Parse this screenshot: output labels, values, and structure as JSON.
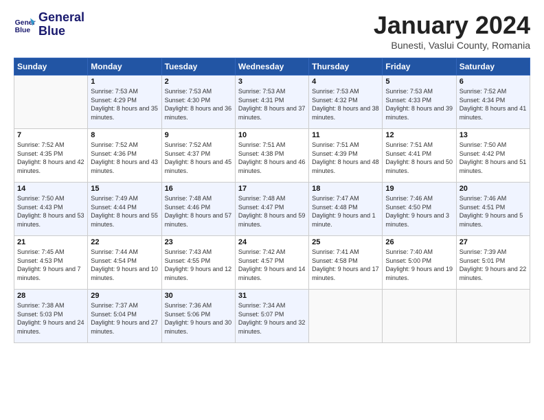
{
  "header": {
    "logo_line1": "General",
    "logo_line2": "Blue",
    "title": "January 2024",
    "subtitle": "Bunesti, Vaslui County, Romania"
  },
  "weekdays": [
    "Sunday",
    "Monday",
    "Tuesday",
    "Wednesday",
    "Thursday",
    "Friday",
    "Saturday"
  ],
  "weeks": [
    [
      {
        "day": "",
        "sunrise": "",
        "sunset": "",
        "daylight": ""
      },
      {
        "day": "1",
        "sunrise": "Sunrise: 7:53 AM",
        "sunset": "Sunset: 4:29 PM",
        "daylight": "Daylight: 8 hours and 35 minutes."
      },
      {
        "day": "2",
        "sunrise": "Sunrise: 7:53 AM",
        "sunset": "Sunset: 4:30 PM",
        "daylight": "Daylight: 8 hours and 36 minutes."
      },
      {
        "day": "3",
        "sunrise": "Sunrise: 7:53 AM",
        "sunset": "Sunset: 4:31 PM",
        "daylight": "Daylight: 8 hours and 37 minutes."
      },
      {
        "day": "4",
        "sunrise": "Sunrise: 7:53 AM",
        "sunset": "Sunset: 4:32 PM",
        "daylight": "Daylight: 8 hours and 38 minutes."
      },
      {
        "day": "5",
        "sunrise": "Sunrise: 7:53 AM",
        "sunset": "Sunset: 4:33 PM",
        "daylight": "Daylight: 8 hours and 39 minutes."
      },
      {
        "day": "6",
        "sunrise": "Sunrise: 7:52 AM",
        "sunset": "Sunset: 4:34 PM",
        "daylight": "Daylight: 8 hours and 41 minutes."
      }
    ],
    [
      {
        "day": "7",
        "sunrise": "Sunrise: 7:52 AM",
        "sunset": "Sunset: 4:35 PM",
        "daylight": "Daylight: 8 hours and 42 minutes."
      },
      {
        "day": "8",
        "sunrise": "Sunrise: 7:52 AM",
        "sunset": "Sunset: 4:36 PM",
        "daylight": "Daylight: 8 hours and 43 minutes."
      },
      {
        "day": "9",
        "sunrise": "Sunrise: 7:52 AM",
        "sunset": "Sunset: 4:37 PM",
        "daylight": "Daylight: 8 hours and 45 minutes."
      },
      {
        "day": "10",
        "sunrise": "Sunrise: 7:51 AM",
        "sunset": "Sunset: 4:38 PM",
        "daylight": "Daylight: 8 hours and 46 minutes."
      },
      {
        "day": "11",
        "sunrise": "Sunrise: 7:51 AM",
        "sunset": "Sunset: 4:39 PM",
        "daylight": "Daylight: 8 hours and 48 minutes."
      },
      {
        "day": "12",
        "sunrise": "Sunrise: 7:51 AM",
        "sunset": "Sunset: 4:41 PM",
        "daylight": "Daylight: 8 hours and 50 minutes."
      },
      {
        "day": "13",
        "sunrise": "Sunrise: 7:50 AM",
        "sunset": "Sunset: 4:42 PM",
        "daylight": "Daylight: 8 hours and 51 minutes."
      }
    ],
    [
      {
        "day": "14",
        "sunrise": "Sunrise: 7:50 AM",
        "sunset": "Sunset: 4:43 PM",
        "daylight": "Daylight: 8 hours and 53 minutes."
      },
      {
        "day": "15",
        "sunrise": "Sunrise: 7:49 AM",
        "sunset": "Sunset: 4:44 PM",
        "daylight": "Daylight: 8 hours and 55 minutes."
      },
      {
        "day": "16",
        "sunrise": "Sunrise: 7:48 AM",
        "sunset": "Sunset: 4:46 PM",
        "daylight": "Daylight: 8 hours and 57 minutes."
      },
      {
        "day": "17",
        "sunrise": "Sunrise: 7:48 AM",
        "sunset": "Sunset: 4:47 PM",
        "daylight": "Daylight: 8 hours and 59 minutes."
      },
      {
        "day": "18",
        "sunrise": "Sunrise: 7:47 AM",
        "sunset": "Sunset: 4:48 PM",
        "daylight": "Daylight: 9 hours and 1 minute."
      },
      {
        "day": "19",
        "sunrise": "Sunrise: 7:46 AM",
        "sunset": "Sunset: 4:50 PM",
        "daylight": "Daylight: 9 hours and 3 minutes."
      },
      {
        "day": "20",
        "sunrise": "Sunrise: 7:46 AM",
        "sunset": "Sunset: 4:51 PM",
        "daylight": "Daylight: 9 hours and 5 minutes."
      }
    ],
    [
      {
        "day": "21",
        "sunrise": "Sunrise: 7:45 AM",
        "sunset": "Sunset: 4:53 PM",
        "daylight": "Daylight: 9 hours and 7 minutes."
      },
      {
        "day": "22",
        "sunrise": "Sunrise: 7:44 AM",
        "sunset": "Sunset: 4:54 PM",
        "daylight": "Daylight: 9 hours and 10 minutes."
      },
      {
        "day": "23",
        "sunrise": "Sunrise: 7:43 AM",
        "sunset": "Sunset: 4:55 PM",
        "daylight": "Daylight: 9 hours and 12 minutes."
      },
      {
        "day": "24",
        "sunrise": "Sunrise: 7:42 AM",
        "sunset": "Sunset: 4:57 PM",
        "daylight": "Daylight: 9 hours and 14 minutes."
      },
      {
        "day": "25",
        "sunrise": "Sunrise: 7:41 AM",
        "sunset": "Sunset: 4:58 PM",
        "daylight": "Daylight: 9 hours and 17 minutes."
      },
      {
        "day": "26",
        "sunrise": "Sunrise: 7:40 AM",
        "sunset": "Sunset: 5:00 PM",
        "daylight": "Daylight: 9 hours and 19 minutes."
      },
      {
        "day": "27",
        "sunrise": "Sunrise: 7:39 AM",
        "sunset": "Sunset: 5:01 PM",
        "daylight": "Daylight: 9 hours and 22 minutes."
      }
    ],
    [
      {
        "day": "28",
        "sunrise": "Sunrise: 7:38 AM",
        "sunset": "Sunset: 5:03 PM",
        "daylight": "Daylight: 9 hours and 24 minutes."
      },
      {
        "day": "29",
        "sunrise": "Sunrise: 7:37 AM",
        "sunset": "Sunset: 5:04 PM",
        "daylight": "Daylight: 9 hours and 27 minutes."
      },
      {
        "day": "30",
        "sunrise": "Sunrise: 7:36 AM",
        "sunset": "Sunset: 5:06 PM",
        "daylight": "Daylight: 9 hours and 30 minutes."
      },
      {
        "day": "31",
        "sunrise": "Sunrise: 7:34 AM",
        "sunset": "Sunset: 5:07 PM",
        "daylight": "Daylight: 9 hours and 32 minutes."
      },
      {
        "day": "",
        "sunrise": "",
        "sunset": "",
        "daylight": ""
      },
      {
        "day": "",
        "sunrise": "",
        "sunset": "",
        "daylight": ""
      },
      {
        "day": "",
        "sunrise": "",
        "sunset": "",
        "daylight": ""
      }
    ]
  ]
}
